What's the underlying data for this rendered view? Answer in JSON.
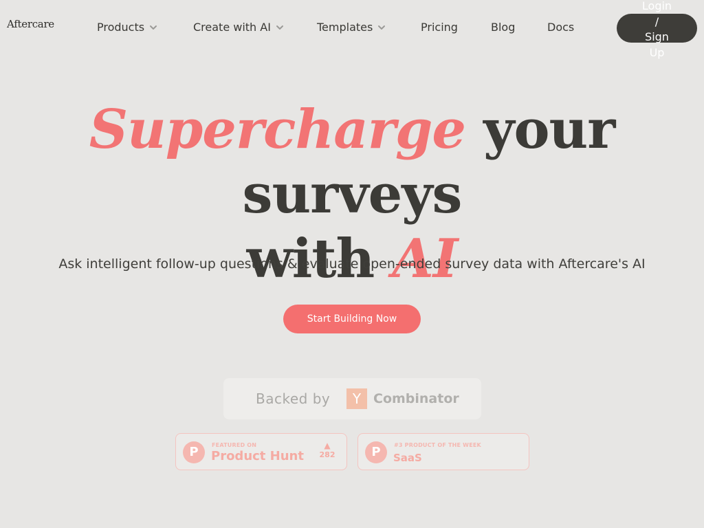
{
  "nav": {
    "logo": "Aftercare",
    "items": [
      {
        "label": "Products",
        "dropdown": true
      },
      {
        "label": "Create with AI",
        "dropdown": true
      },
      {
        "label": "Templates",
        "dropdown": true
      },
      {
        "label": "Pricing",
        "dropdown": false
      },
      {
        "label": "Blog",
        "dropdown": false
      },
      {
        "label": "Docs",
        "dropdown": false
      }
    ],
    "login_label": "Login / Sign Up"
  },
  "hero": {
    "title_accent_1": "Supercharge",
    "title_plain_1": " your surveys",
    "title_plain_2": "with ",
    "title_accent_2": "AI",
    "subtitle": "Ask intelligent follow-up questions & evaluate open-ended survey data with Aftercare's AI",
    "cta_label": "Start Building Now"
  },
  "backed": {
    "label": "Backed by",
    "yc_mark": "Y",
    "yc_name": "Combinator"
  },
  "badges": [
    {
      "icon_letter": "P",
      "small": "FEATURED ON",
      "big": "Product Hunt",
      "upvote_arrow": "▲",
      "upvotes": "282"
    },
    {
      "icon_letter": "P",
      "small": "#3 PRODUCT OF THE WEEK",
      "big": "SaaS"
    }
  ],
  "colors": {
    "background": "#e7e6e4",
    "accent": "#f27474",
    "cta": "#f46f6f",
    "dark": "#3c3b37"
  }
}
